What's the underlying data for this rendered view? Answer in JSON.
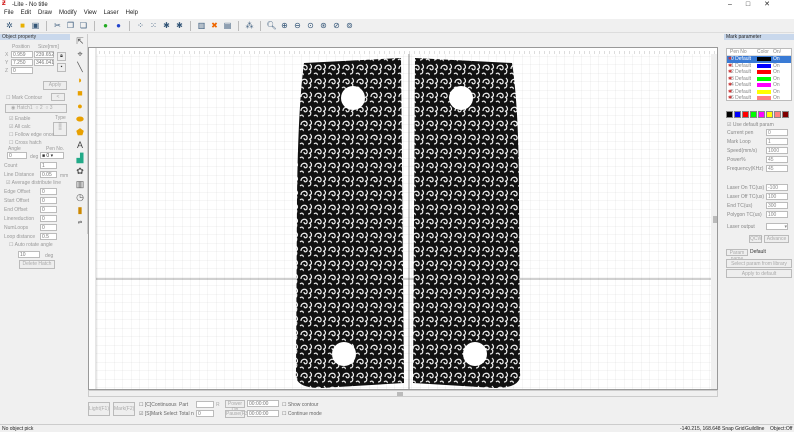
{
  "window": {
    "title": "-Lite - No title"
  },
  "menu": [
    "File",
    "Edit",
    "Draw",
    "Modify",
    "View",
    "Laser",
    "Help"
  ],
  "object_property": {
    "header": "Object property",
    "position_label": "Position",
    "size_label": "Size[mm]",
    "x_label": "X",
    "y_label": "Y",
    "z_label": "Z",
    "x_pos": "0.959",
    "y_pos": "7.250",
    "z_pos": "0",
    "x_size": "239.652",
    "y_size": "346.041",
    "apply": "Apply",
    "mark_contour": "Mark Contour",
    "hatch1": "Hatch1",
    "hatch2": "2",
    "hatch3": "3",
    "enable": "Enable",
    "type": "Type",
    "all_calc": "All calc",
    "follow_edge": "Follow edge once",
    "cross_hatch": "Cross hatch",
    "angle": "Angle",
    "angle_val": "0",
    "deg": "deg",
    "pen_no": "Pen No.",
    "pen_val": "0",
    "count": "Count",
    "count_val": "1",
    "line_distance": "Line Distance",
    "line_distance_val": "0.05",
    "mm": "mm",
    "avg_distribute": "Average distribute line",
    "edge_offset": "Edge Offset",
    "start_offset": "Start Offset",
    "end_offset": "End Offset",
    "line_reduction": "Linereduction",
    "num_loops": "NumLoops",
    "loop_distance": "Loop distance",
    "loop_distance_val": "0.5",
    "zero": "0",
    "auto_rotate": "Auto rotate angle",
    "rotate_val": "10",
    "delete_hatch": "Delete Hatch"
  },
  "mark_parameter": {
    "header": "Mark parameter",
    "columns": [
      "Pen No",
      "Color",
      "On/"
    ],
    "pens": [
      {
        "name": "0 Default",
        "color": "#000000",
        "on": "On"
      },
      {
        "name": "1 Default",
        "color": "#0000ff",
        "on": "On"
      },
      {
        "name": "2 Default",
        "color": "#ff0000",
        "on": "On"
      },
      {
        "name": "3 Default",
        "color": "#00ff00",
        "on": "On"
      },
      {
        "name": "4 Default",
        "color": "#ff00ff",
        "on": "On"
      },
      {
        "name": "5 Default",
        "color": "#ffff00",
        "on": "On"
      },
      {
        "name": "6 Default",
        "color": "#ff8080",
        "on": "On"
      }
    ],
    "palette": [
      "#000000",
      "#0000ff",
      "#ff0000",
      "#00ff00",
      "#ff00ff",
      "#ffff00",
      "#ff8080",
      "#800000"
    ],
    "use_default": "Use default param",
    "current_pen": "Current pen",
    "current_pen_val": "0",
    "mark_loop": "Mark Loop",
    "mark_loop_val": "1",
    "speed": "Speed(mm/s)",
    "speed_val": "1000",
    "power": "Power%",
    "power_val": "45",
    "frequency": "Frequency(KHz)",
    "frequency_val": "45",
    "laser_on": "Laser On TC(us)",
    "laser_on_val": "-100",
    "laser_off": "Laser Off TC(us)",
    "laser_off_val": "100",
    "end_tc": "End TC(us)",
    "end_tc_val": "300",
    "polygon_tc": "Polygon TC(us)",
    "polygon_tc_val": "100",
    "laser_output": "Laser output",
    "qcw": "QCW",
    "advance": "Advance",
    "param_name": "Param name",
    "param_name_val": "Default",
    "select_param": "Select param from library",
    "apply_default": "Apply to default"
  },
  "bottom": {
    "light": "Light(F1)",
    "mark": "Mark(F2)",
    "continuous": "[C]Continuous",
    "mark_select": "[S]Mark Select",
    "part": "Part",
    "part_unit": "R",
    "total": "Total n",
    "total_val": "0",
    "power_on": "Power On",
    "pause": "Pause(F3)",
    "time1": "00:00:00",
    "time2": "00:00:00",
    "show_contour": "Show contour",
    "continue_mode": "Continue mode"
  },
  "status": {
    "left": "No object pick",
    "coords": "-140.215, 168.648",
    "snap": "Snap Grid",
    "guideline": "Guildline",
    "object": "Object:Off"
  }
}
